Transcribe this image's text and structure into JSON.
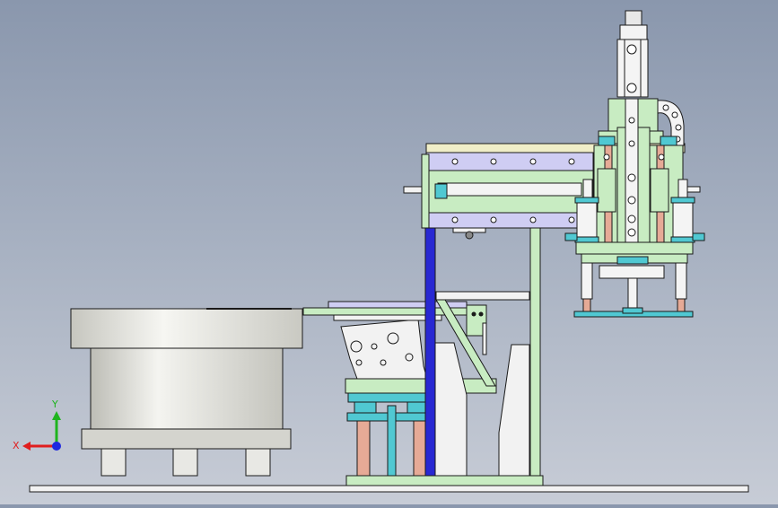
{
  "view": {
    "background_top": "#8a97ad",
    "background_bottom": "#c7ccd6",
    "line_color": "#1a1a1a"
  },
  "triad": {
    "x_label": "X",
    "y_label": "Y",
    "x_color": "#e01e1e",
    "y_color": "#1eb41e",
    "z_color": "#1e28e0"
  },
  "colors": {
    "bowl_metal": "#d8d8d2",
    "frame_green": "#c8ecc2",
    "plate_lavender": "#cfcdf3",
    "cyl_cyan": "#50c8d2",
    "rod_pink": "#e6aa96",
    "blue_post": "#2828d2",
    "white_part": "#f2f2f2"
  },
  "parts": [
    "vibratory-bowl-feeder",
    "linear-feeder-track",
    "gantry-frame",
    "horizontal-slide-module",
    "vertical-lift-cylinder",
    "gripper-head",
    "cable-drag-chain",
    "base-plate"
  ]
}
